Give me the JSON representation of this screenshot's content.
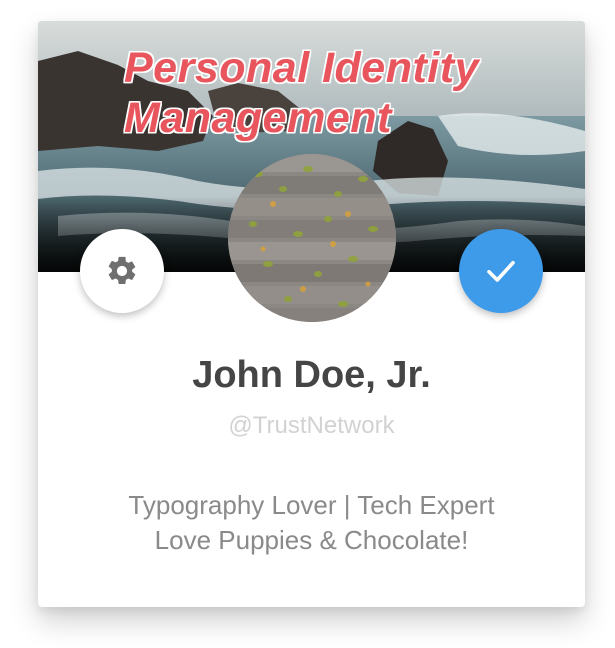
{
  "cover": {
    "headline_line1": "Personal Identity",
    "headline_line2": "Management",
    "headline_color": "#e9555c",
    "scene": "rocky-seashore-waves"
  },
  "avatar": {
    "scene": "wooden-deck-with-leaves"
  },
  "actions": {
    "settings_icon": "gear-icon",
    "verify_icon": "checkmark-icon",
    "verify_color": "#3d9be9"
  },
  "profile": {
    "name": "John Doe, Jr.",
    "handle": "@TrustNetwork",
    "bio_line1": "Typography Lover | Tech Expert",
    "bio_line2": "Love Puppies & Chocolate!"
  }
}
